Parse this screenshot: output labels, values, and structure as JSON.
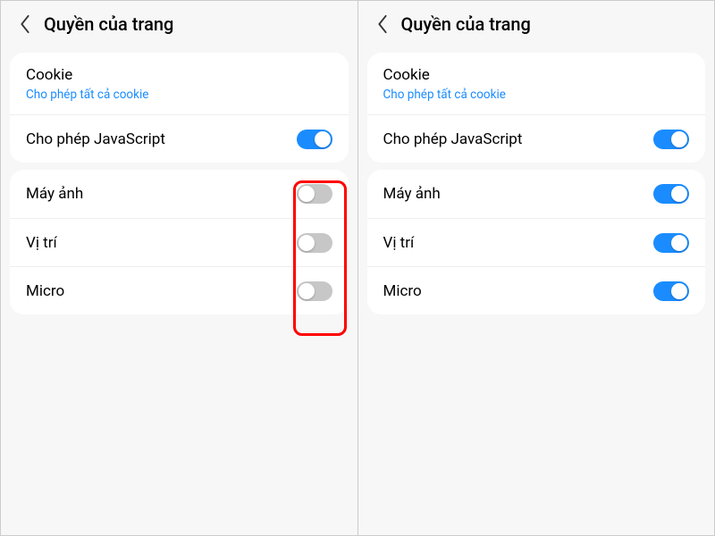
{
  "left": {
    "header": {
      "title": "Quyền của trang"
    },
    "card1": {
      "cookie": {
        "label": "Cookie",
        "sub": "Cho phép tất cả cookie"
      },
      "javascript": {
        "label": "Cho phép JavaScript",
        "on": true
      }
    },
    "card2": {
      "camera": {
        "label": "Máy ảnh",
        "on": false
      },
      "location": {
        "label": "Vị trí",
        "on": false
      },
      "micro": {
        "label": "Micro",
        "on": false
      }
    }
  },
  "right": {
    "header": {
      "title": "Quyền của trang"
    },
    "card1": {
      "cookie": {
        "label": "Cookie",
        "sub": "Cho phép tất cả cookie"
      },
      "javascript": {
        "label": "Cho phép JavaScript",
        "on": true
      }
    },
    "card2": {
      "camera": {
        "label": "Máy ảnh",
        "on": true
      },
      "location": {
        "label": "Vị trí",
        "on": true
      },
      "micro": {
        "label": "Micro",
        "on": true
      }
    }
  }
}
